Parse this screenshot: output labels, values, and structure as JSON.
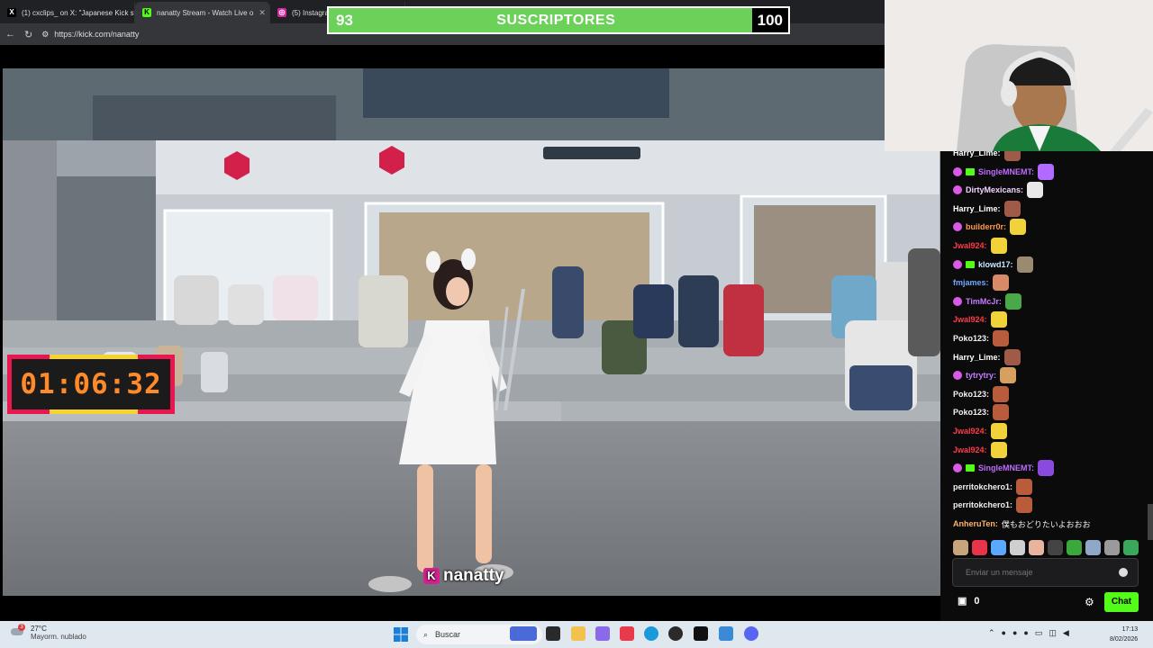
{
  "browser": {
    "tabs": [
      {
        "title": "(1) cxclips_ on X: \"Japanese Kick st",
        "fav": "X",
        "fav_color": "#000000",
        "close": "✕"
      },
      {
        "title": "nanatty Stream - Watch Live o",
        "fav": "K",
        "fav_color": "#53fc18",
        "close": "✕"
      },
      {
        "title": "(5) Instagra",
        "fav": "◎",
        "fav_color": "#d6249f",
        "close": ""
      }
    ],
    "url": "https://kick.com/nanatty"
  },
  "subscribers": {
    "current": "93",
    "label": "SUSCRIPTORES",
    "goal": "100",
    "progress": 0.93
  },
  "timer": "01:06:32",
  "watermark": "nanatty",
  "chat": {
    "messages": [
      {
        "user": "Harry_Lime:",
        "color": "#ffffff",
        "badges": [],
        "text": "",
        "emote": "#a05a48"
      },
      {
        "user": "SingleMNEMT:",
        "color": "#bf6bff",
        "badges": [
          "sub",
          "gift"
        ],
        "text": "",
        "emote": "#b36bff"
      },
      {
        "user": "DirtyMexicans:",
        "color": "#f0d5ff",
        "badges": [
          "sub"
        ],
        "text": "",
        "emote": "#e8e8e8"
      },
      {
        "user": "Harry_Lime:",
        "color": "#ffffff",
        "badges": [],
        "text": "",
        "emote": "#a05a48"
      },
      {
        "user": "builderr0r:",
        "color": "#ff9a4a",
        "badges": [
          "sub"
        ],
        "text": "",
        "emote": "#f1d23a"
      },
      {
        "user": "Jwal924:",
        "color": "#ff3b4a",
        "badges": [],
        "text": "",
        "emote": "#f1d23a"
      },
      {
        "user": "klowd17:",
        "color": "#c9e8ff",
        "badges": [
          "sub",
          "gift"
        ],
        "text": "",
        "emote": "#9a8a70"
      },
      {
        "user": "fmjames:",
        "color": "#6fa8ff",
        "badges": [],
        "text": "",
        "emote": "#d88a66"
      },
      {
        "user": "TimMcJr:",
        "color": "#c57bff",
        "badges": [
          "sub"
        ],
        "text": "",
        "emote": "#4aa84a"
      },
      {
        "user": "Jwal924:",
        "color": "#ff3b4a",
        "badges": [],
        "text": "",
        "emote": "#f1d23a"
      },
      {
        "user": "Poko123:",
        "color": "#f2f2f2",
        "badges": [],
        "text": "",
        "emote": "#b85c3c"
      },
      {
        "user": "Harry_Lime:",
        "color": "#ffffff",
        "badges": [],
        "text": "",
        "emote": "#a05a48"
      },
      {
        "user": "tytrytry:",
        "color": "#c57bff",
        "badges": [
          "sub"
        ],
        "text": "",
        "emote": "#d6a060"
      },
      {
        "user": "Poko123:",
        "color": "#f2f2f2",
        "badges": [],
        "text": "",
        "emote": "#b85c3c"
      },
      {
        "user": "Poko123:",
        "color": "#f2f2f2",
        "badges": [],
        "text": "",
        "emote": "#b85c3c"
      },
      {
        "user": "Jwal924:",
        "color": "#ff3b4a",
        "badges": [],
        "text": "",
        "emote": "#f1d23a"
      },
      {
        "user": "Jwal924:",
        "color": "#ff3b4a",
        "badges": [],
        "text": "",
        "emote": "#f1d23a"
      },
      {
        "user": "SingleMNEMT:",
        "color": "#bf6bff",
        "badges": [
          "sub",
          "gift"
        ],
        "text": "",
        "emote": "#8a4adb"
      },
      {
        "user": "perritokchero1:",
        "color": "#f2f2f2",
        "badges": [],
        "text": "",
        "emote": "#b85c3c"
      },
      {
        "user": "perritokchero1:",
        "color": "#f2f2f2",
        "badges": [],
        "text": "",
        "emote": "#b85c3c"
      },
      {
        "user": "AnheruTen:",
        "color": "#ffb36b",
        "badges": [],
        "text": "僕もおどりたいよおおお",
        "emote": ""
      }
    ],
    "emote_bar": [
      "#c9a37a",
      "#e8344a",
      "#5aa8ff",
      "#cfcfcf",
      "#e8b4a0",
      "#444444",
      "#3aa83a",
      "#8fa8c8",
      "#9a9a9a",
      "#3aa85a"
    ],
    "input_placeholder": "Enviar un mensaje",
    "store_count": "0",
    "chat_button": "Chat"
  },
  "taskbar": {
    "weather_temp": "27°C",
    "weather_desc": "Mayorm. nublado",
    "weather_badge": "3",
    "search_label": "Buscar",
    "time": "17:13",
    "date": "8/02/2026"
  }
}
